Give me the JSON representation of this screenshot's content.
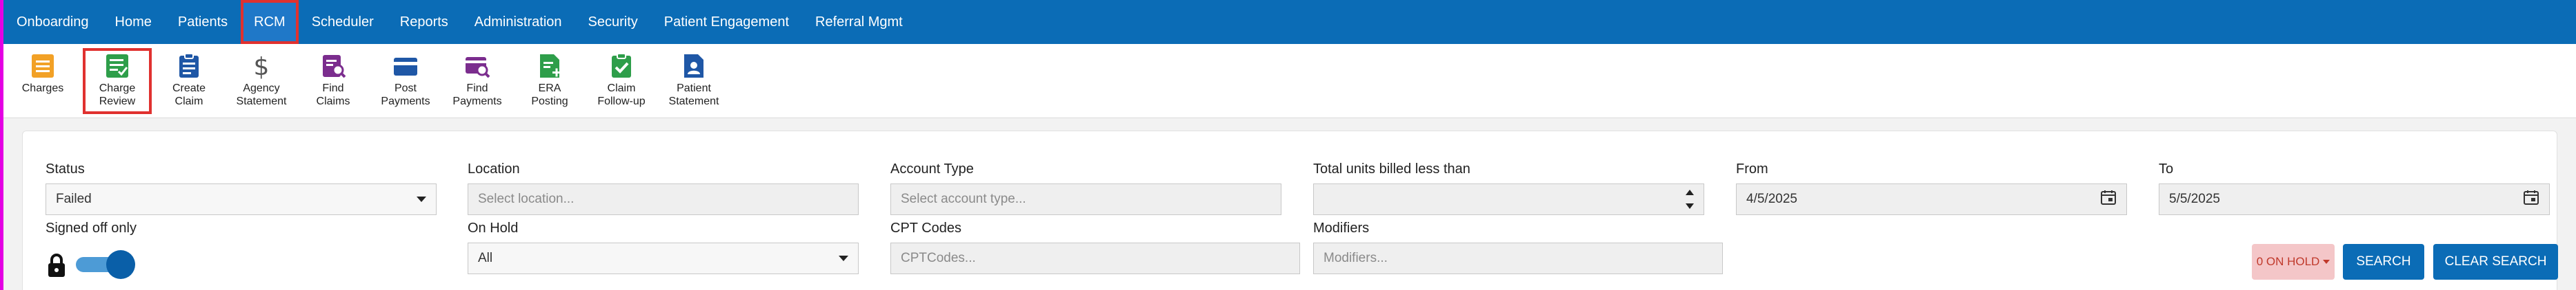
{
  "nav": {
    "items": [
      {
        "label": "Onboarding"
      },
      {
        "label": "Home"
      },
      {
        "label": "Patients"
      },
      {
        "label": "RCM"
      },
      {
        "label": "Scheduler"
      },
      {
        "label": "Reports"
      },
      {
        "label": "Administration"
      },
      {
        "label": "Security"
      },
      {
        "label": "Patient Engagement"
      },
      {
        "label": "Referral Mgmt"
      }
    ],
    "active": "RCM"
  },
  "toolbar": {
    "items": [
      {
        "label": "Charges",
        "icon": "charges-icon",
        "color": "#f2a126"
      },
      {
        "label": "Charge\nReview",
        "icon": "charge-review-icon",
        "color": "#2e9e4a"
      },
      {
        "label": "Create\nClaim",
        "icon": "create-claim-icon",
        "color": "#1f57a6"
      },
      {
        "label": "Agency\nStatement",
        "icon": "dollar-icon",
        "color": "#555555"
      },
      {
        "label": "Find\nClaims",
        "icon": "find-claims-icon",
        "color": "#7b2d8e"
      },
      {
        "label": "Post\nPayments",
        "icon": "post-payments-icon",
        "color": "#1f57a6"
      },
      {
        "label": "Find\nPayments",
        "icon": "find-payments-icon",
        "color": "#7b2d8e"
      },
      {
        "label": "ERA\nPosting",
        "icon": "era-posting-icon",
        "color": "#2e9e4a"
      },
      {
        "label": "Claim\nFollow-up",
        "icon": "claim-followup-icon",
        "color": "#2e9e4a"
      },
      {
        "label": "Patient\nStatement",
        "icon": "patient-statement-icon",
        "color": "#1f57a6"
      }
    ],
    "active": "Charge Review"
  },
  "filters": {
    "status": {
      "label": "Status",
      "value": "Failed"
    },
    "location": {
      "label": "Location",
      "placeholder": "Select location..."
    },
    "account_type": {
      "label": "Account Type",
      "placeholder": "Select account type..."
    },
    "units": {
      "label": "Total units billed less than",
      "value": ""
    },
    "from": {
      "label": "From",
      "value": "4/5/2025"
    },
    "to": {
      "label": "To",
      "value": "5/5/2025"
    },
    "signed_off": {
      "label": "Signed off only",
      "checked": true
    },
    "on_hold": {
      "label": "On Hold",
      "value": "All"
    },
    "cpt": {
      "label": "CPT Codes",
      "placeholder": "CPTCodes..."
    },
    "modifiers": {
      "label": "Modifiers",
      "placeholder": "Modifiers..."
    }
  },
  "actions": {
    "on_hold_badge": "0 ON HOLD",
    "search": "SEARCH",
    "clear_search": "CLEAR SEARCH"
  },
  "colors": {
    "nav_bg": "#0b6cb6",
    "highlight": "#e0312f",
    "accent_strip": "#e400e4"
  }
}
